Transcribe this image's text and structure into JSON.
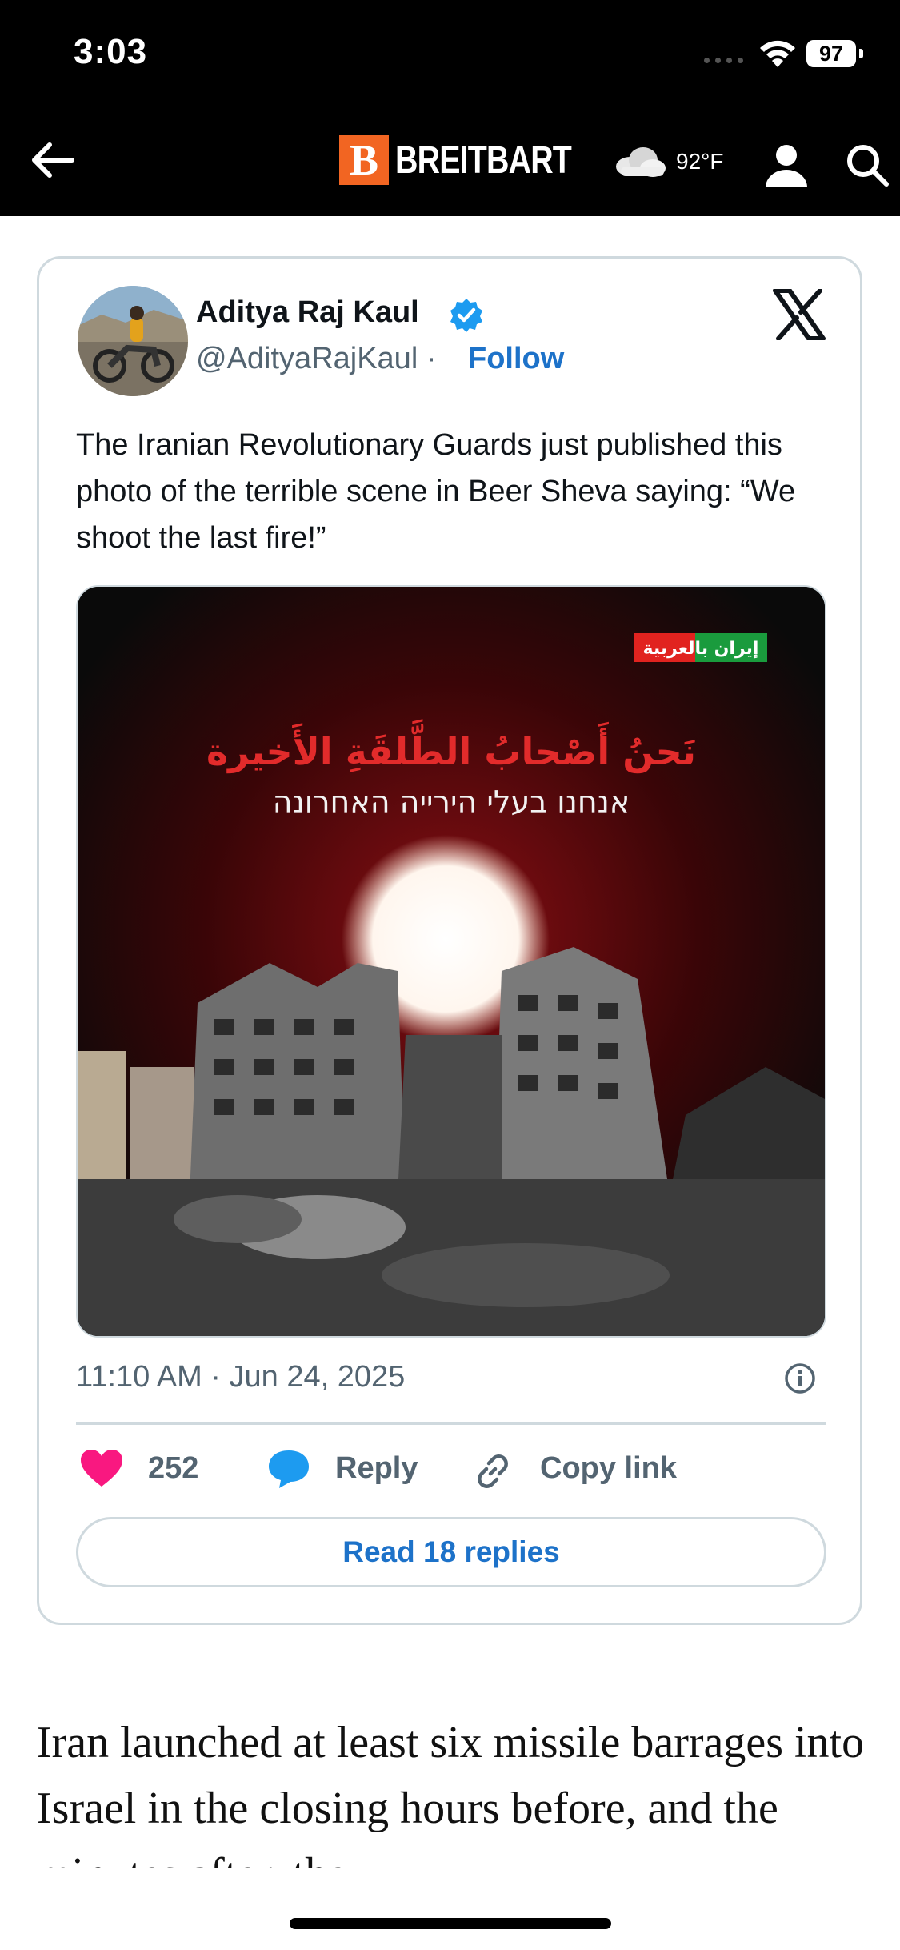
{
  "status_bar": {
    "time": "3:03",
    "battery": "97"
  },
  "nav": {
    "logo_letter": "B",
    "logo_text": "BREITBART",
    "weather_temp": "92°F"
  },
  "tweet": {
    "author_name": "Aditya Raj Kaul",
    "handle": "@AdityaRajKaul",
    "separator": "·",
    "follow_label": "Follow",
    "text": "The Iranian Revolutionary Guards just published this photo of the terrible scene in Beer Sheva saying: “We shoot the last fire!”",
    "image": {
      "badge_text": "إيران بالعربية",
      "arabic_headline": "نَحنُ أَصْحابُ الطَّلقَةِ الأَخيرة",
      "hebrew_headline": "אנחנו בעלי הירייה האחרונה"
    },
    "timestamp": "11:10 AM · Jun 24, 2025",
    "likes": "252",
    "reply_label": "Reply",
    "copy_link_label": "Copy link",
    "read_replies_label": "Read 18 replies"
  },
  "article": {
    "text": "Iran launched at least six missile barrages into Israel in the closing hours before, and the minutes after, the"
  },
  "colors": {
    "accent_blue": "#1d72c9",
    "heart_pink": "#f91880",
    "brand_orange": "#f26522"
  }
}
